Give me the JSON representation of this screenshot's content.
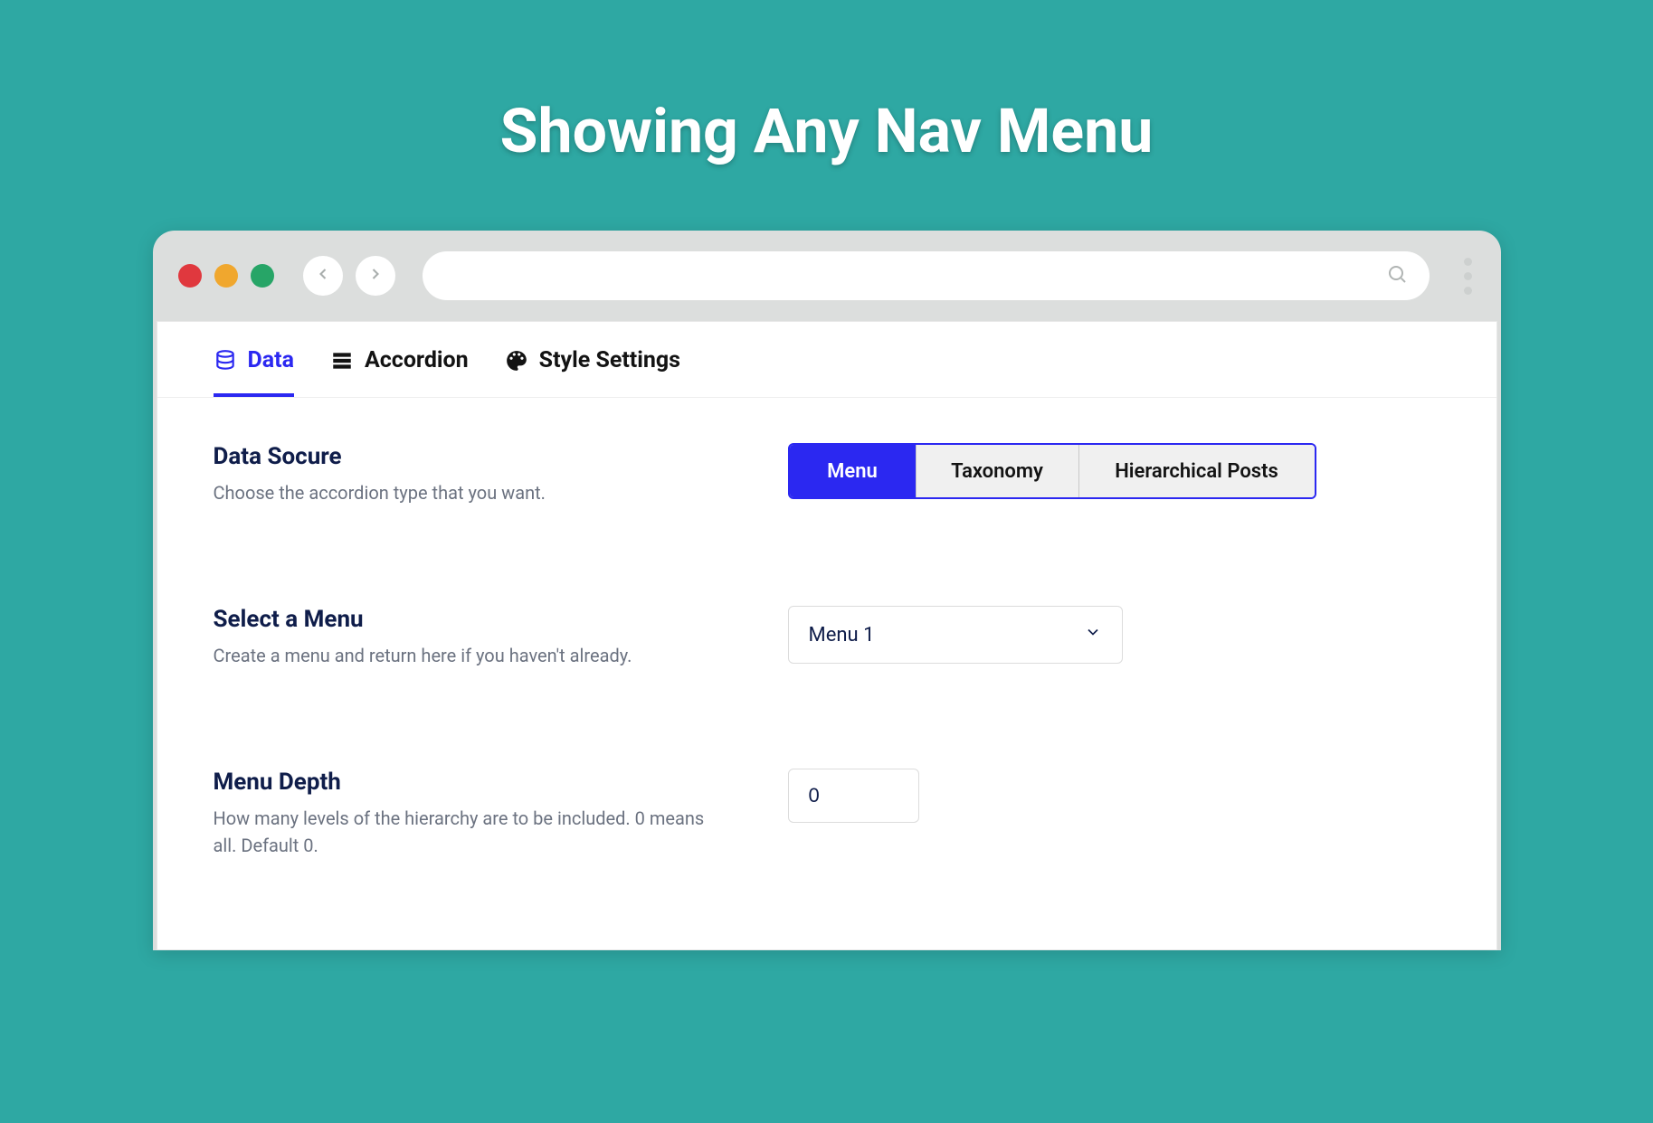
{
  "page": {
    "title": "Showing Any Nav Menu"
  },
  "tabs": [
    {
      "label": "Data",
      "active": true
    },
    {
      "label": "Accordion",
      "active": false
    },
    {
      "label": "Style Settings",
      "active": false
    }
  ],
  "settings": {
    "dataSource": {
      "title": "Data Socure",
      "desc": "Choose the accordion type that you want.",
      "options": [
        {
          "label": "Menu",
          "active": true
        },
        {
          "label": "Taxonomy",
          "active": false
        },
        {
          "label": "Hierarchical Posts",
          "active": false
        }
      ]
    },
    "selectMenu": {
      "title": "Select a Menu",
      "desc": "Create a menu and return here if you haven't already.",
      "value": "Menu 1"
    },
    "menuDepth": {
      "title": "Menu Depth",
      "desc": "How many levels of the hierarchy are to be included. 0 means all. Default 0.",
      "value": "0"
    }
  }
}
